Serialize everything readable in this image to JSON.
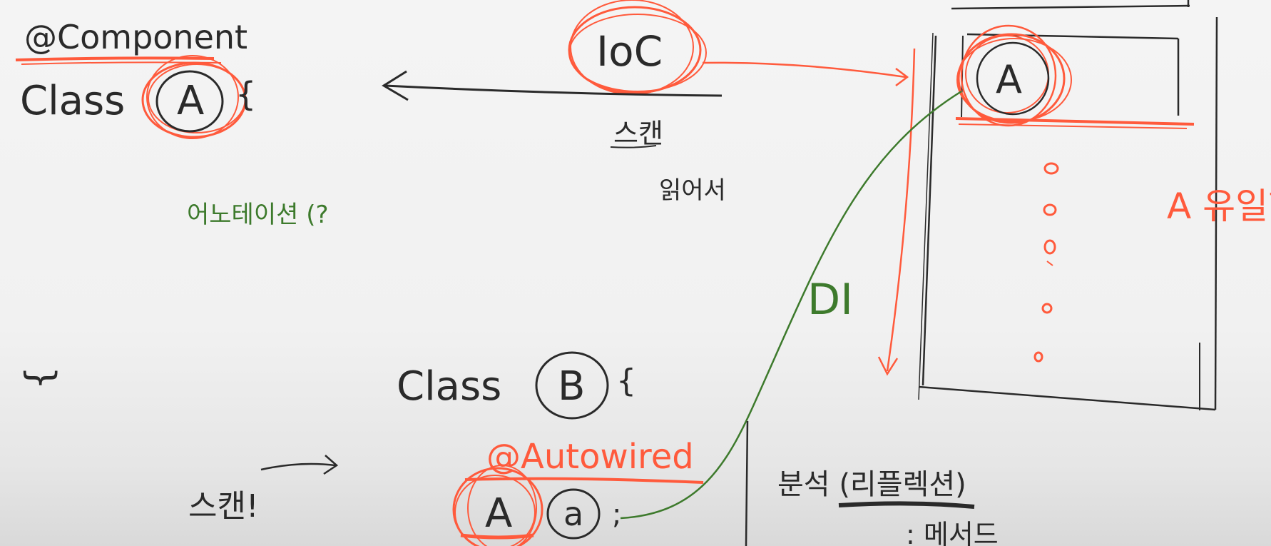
{
  "colors": {
    "ink": "#2a2a2a",
    "red": "#ff5a3c",
    "green": "#3d7a2c",
    "board": "#f3f3f3"
  },
  "left": {
    "annotation": "@Component",
    "class_keyword": "Class",
    "class_name": "A",
    "brace": "{",
    "green_note": "어노테이션 (?",
    "close_mark": "}"
  },
  "center": {
    "ioc": "IoC",
    "scan": "스캔",
    "read": "읽어서",
    "di": "DI"
  },
  "container": {
    "top_item": "A",
    "side_note": "A 유일한"
  },
  "classB": {
    "class_keyword": "Class",
    "class_name": "B",
    "brace": "{",
    "annotation": "@Autowired",
    "field_type": "A",
    "field_name": "a",
    "semicolon": ";"
  },
  "bottom_left": {
    "scan": "스캔!"
  },
  "bottom_right": {
    "title": "분석 (리플렉션)",
    "sub": ": 메서드"
  }
}
